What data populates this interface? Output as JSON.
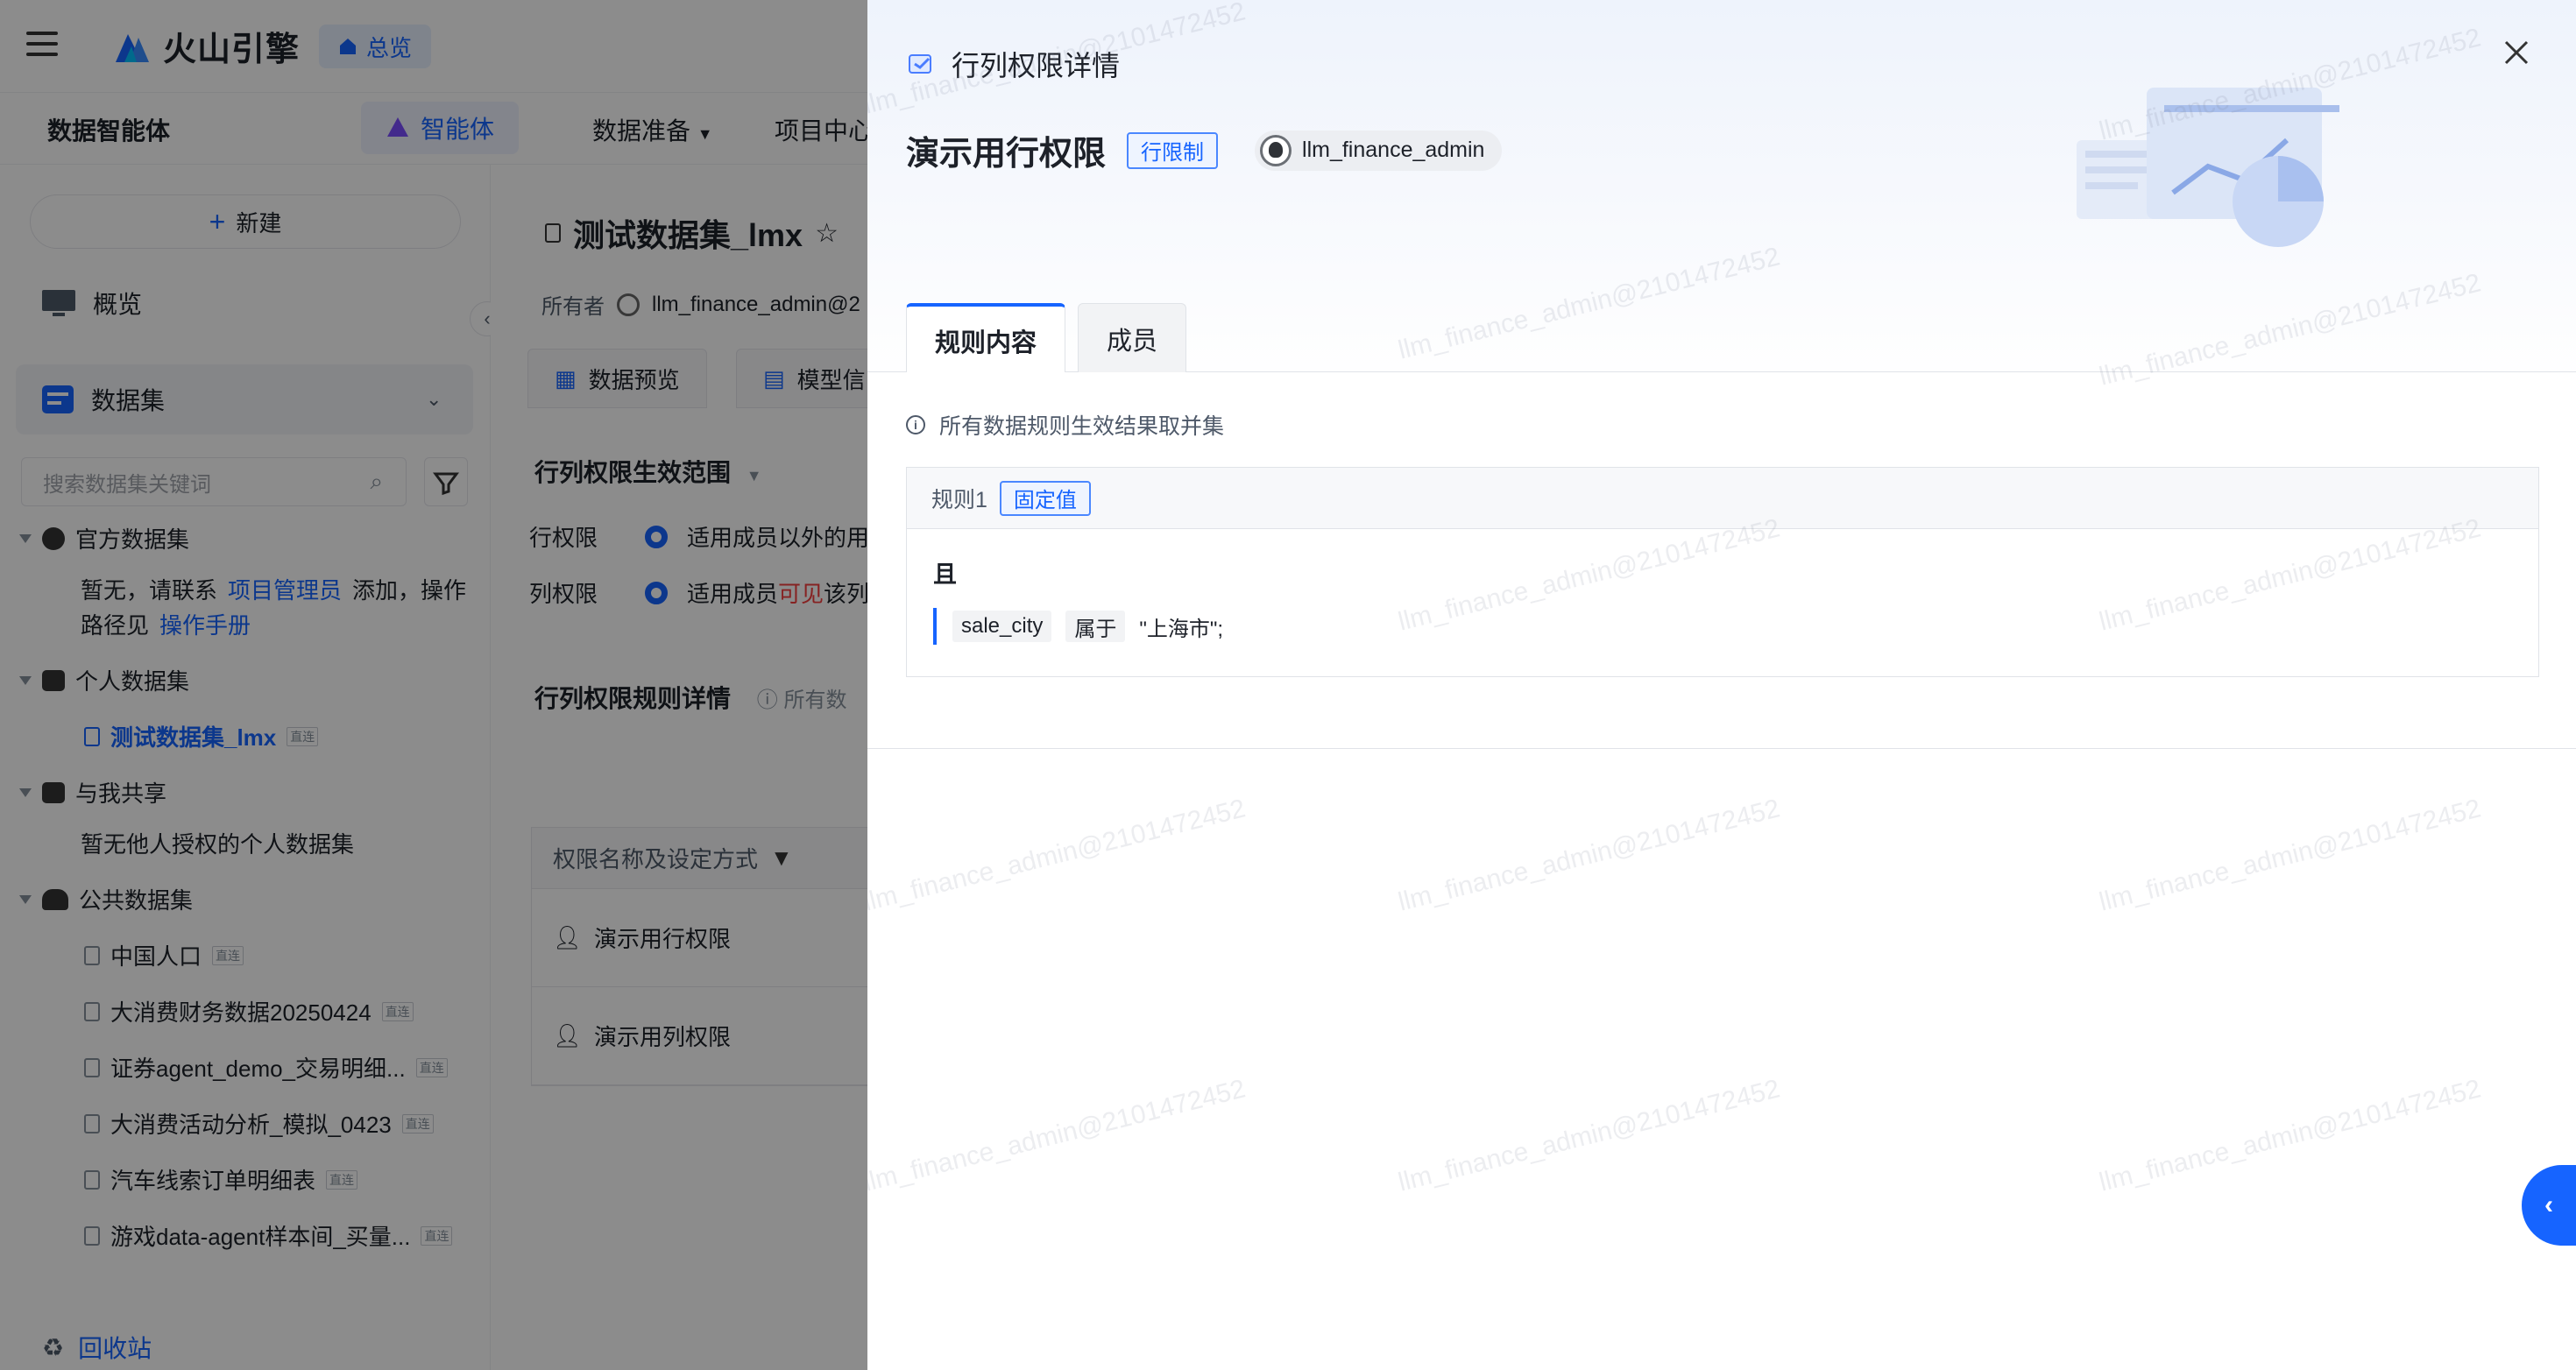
{
  "topbar": {
    "brand": "火山引擎",
    "home_badge": "总览"
  },
  "navbar": {
    "title": "数据智能体",
    "agent": "智能体",
    "data_prep": "数据准备",
    "project_center": "项目中心"
  },
  "sidebar": {
    "new_button": "新建",
    "overview": "概览",
    "dataset": "数据集",
    "search_placeholder": "搜索数据集关键词",
    "tree": {
      "official": "官方数据集",
      "official_empty_a": "暂无，请联系",
      "official_empty_link1": "项目管理员",
      "official_empty_b": "添加，操作",
      "official_empty_c": "路径见",
      "official_empty_link2": "操作手册",
      "personal": "个人数据集",
      "personal_item": "测试数据集_lmx",
      "shared": "与我共享",
      "shared_empty": "暂无他人授权的个人数据集",
      "public": "公共数据集",
      "public_items": [
        "中国人口",
        "大消费财务数据20250424",
        "证券agent_demo_交易明细...",
        "大消费活动分析_模拟_0423",
        "汽车线索订单明细表",
        "游戏data-agent样本间_买量..."
      ],
      "mini_tag": "直连"
    },
    "trash": "回收站"
  },
  "main": {
    "dataset_title": "测试数据集_lmx",
    "owner_label": "所有者",
    "owner_value": "llm_finance_admin@2",
    "tab_preview": "数据预览",
    "tab_model": "模型信",
    "scope_title": "行列权限生效范围",
    "row_label": "行权限",
    "row_value": "适用成员以外的用",
    "col_label": "列权限",
    "col_value_a": "适用成员",
    "col_value_visible": "可见",
    "col_value_b": "该列",
    "rules_title": "行列权限规则详情",
    "rules_hint": "所有数",
    "table_head": "权限名称及设定方式",
    "rows": [
      "演示用行权限",
      "演示用列权限"
    ]
  },
  "drawer": {
    "title": "行列权限详情",
    "permission_name": "演示用行权限",
    "permission_type": "行限制",
    "owner": "llm_finance_admin",
    "tabs": [
      "规则内容",
      "成员"
    ],
    "hint": "所有数据规则生效结果取并集",
    "rule": {
      "name": "规则1",
      "type": "固定值",
      "logic": "且",
      "field": "sale_city",
      "operator": "属于",
      "value": "\"上海市\";"
    }
  },
  "watermark": "llm_finance_admin@2101472452",
  "colors": {
    "primary": "#1664ff",
    "overlay": "rgba(0,0,0,0.45)"
  }
}
